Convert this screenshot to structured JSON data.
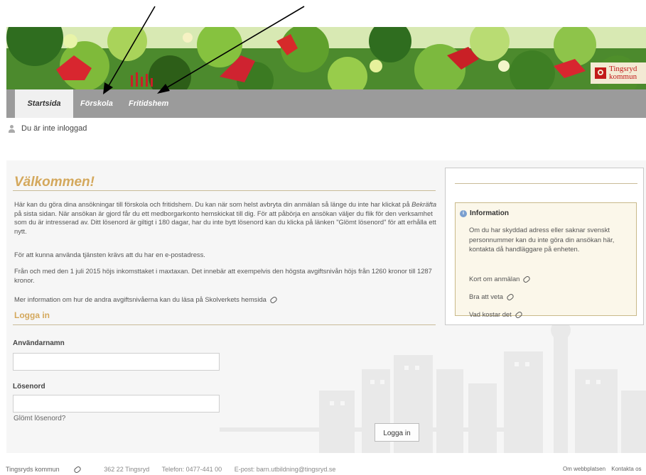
{
  "header": {
    "logo_text_line1": "Tingsryd",
    "logo_text_line2": "kommun"
  },
  "nav": {
    "tabs": [
      {
        "label": "Startsida",
        "active": true
      },
      {
        "label": "Förskola",
        "active": false
      },
      {
        "label": "Fritidshem",
        "active": false
      }
    ]
  },
  "status": {
    "login_text": "Du är inte inloggad"
  },
  "main": {
    "title": "Välkommen!",
    "intro_before": "Här kan du göra dina ansökningar till förskola och fritidshem. Du kan när som helst avbryta din anmälan så länge du inte har klickat på ",
    "intro_emph": "Bekräfta",
    "intro_after": " på sista sidan. När ansökan är gjord får du ett medborgarkonto hemskickat till dig. För att påbörja en ansökan väljer du flik för den verksamhet som du är intresserad av. Ditt lösenord är giltigt i 180 dagar, har du inte bytt lösenord kan du klicka på länken \"Glömt lösenord\" för att erhålla ett nytt.",
    "email_note": "För att kunna använda tjänsten krävs att du har en e-postadress.",
    "fee_note": "Från och med den 1 juli 2015 höjs inkomsttaket i maxtaxan. Det innebär att exempelvis den högsta avgiftsnivån höjs från 1260 kronor till 1287 kronor.",
    "more_info": "Mer information om hur de andra avgiftsnivåerna kan du läsa på Skolverkets hemsida"
  },
  "login": {
    "title": "Logga in",
    "username_label": "Användarnamn",
    "username_value": "",
    "password_label": "Lösenord",
    "password_value": "",
    "forgot_label": "Glömt lösenord?",
    "button_label": "Logga in"
  },
  "sidebar": {
    "info_title": "Information",
    "info_text": "Om du har skyddad adress eller saknar svenskt personnummer kan du inte göra din ansökan här, kontakta då handläggare på enheten.",
    "links": [
      "Kort om anmälan",
      "Bra att veta",
      "Vad kostar det"
    ]
  },
  "footer": {
    "org": "Tingsryds kommun",
    "address": "362 22 Tingsryd",
    "phone": "Telefon: 0477-441 00",
    "email": "E-post: barn.utbildning@tingsryd.se",
    "right_links": [
      "Om webbplatsen",
      "Kontakta os"
    ]
  },
  "colors": {
    "accent": "#d4a85c",
    "nav_bar": "#9b9b9b",
    "banner_green": "#4c8a2d",
    "brand_red": "#c21a1a"
  },
  "icons": [
    "user-icon",
    "link-icon",
    "info-icon",
    "arrow-annotation"
  ]
}
